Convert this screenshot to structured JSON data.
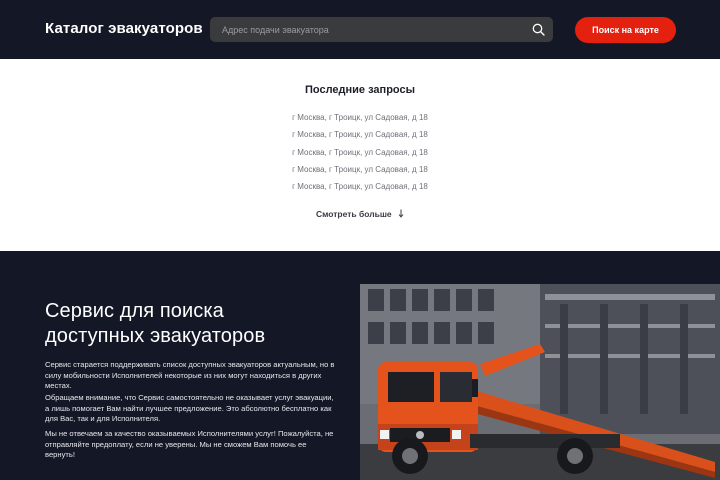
{
  "header": {
    "logo": "Каталог эвакуаторов",
    "search_placeholder": "Адрес подачи эвакуатора",
    "map_button": "Поиск на карте"
  },
  "recent": {
    "title": "Последние запросы",
    "items": [
      "г Москва, г Троицк, ул Садовая, д 18",
      "г Москва, г Троицк, ул Садовая, д 18",
      "г Москва, г Троицк, ул Садовая, д 18",
      "г Москва, г Троицк, ул Садовая, д 18",
      "г Москва, г Троицк, ул Садовая, д 18"
    ],
    "more_label": "Смотреть больше"
  },
  "service": {
    "title_line1": "Сервис для поиска",
    "title_line2": "доступных эвакуаторов",
    "paragraphs": [
      "Сервис старается поддерживать список доступных эвакуаторов актуальным, но в силу мобильности Исполнителей некоторые из них могут находиться в других местах.",
      "Обращаем внимание, что Сервис самостоятельно не оказывает услуг эвакуации, а лишь помогает Вам найти лучшее предложение. Это абсолютно бесплатно как для Вас, так и для Исполнителя.",
      "Мы не отвечаем за качество оказываемых Исполнителями услуг! Пожалуйста, не отправляйте предоплату, если не уверены. Мы не сможем Вам помочь ее вернуть!"
    ]
  },
  "colors": {
    "header_bg": "#141726",
    "accent": "#e4210f",
    "search_bg": "#3a3b3d",
    "truck_orange": "#e5531c"
  },
  "icons": {
    "search": "search-icon",
    "more": "arrow-down-icon"
  }
}
